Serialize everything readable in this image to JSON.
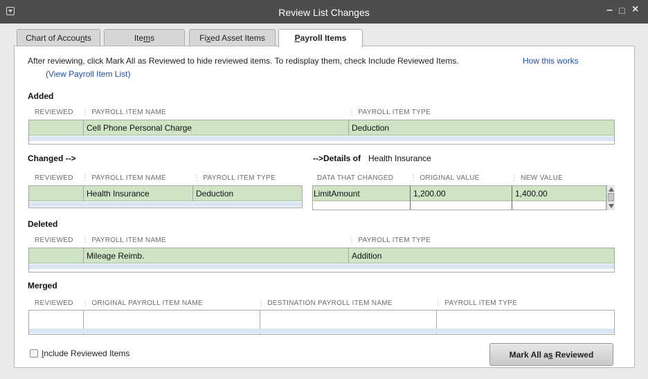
{
  "window": {
    "title": "Review List Changes",
    "controls": {
      "minimize": "–",
      "restore": "□",
      "close": "×"
    }
  },
  "tabs": [
    {
      "label_pre": "Chart of Accou",
      "label_u": "n",
      "label_post": "ts"
    },
    {
      "label_pre": "Ite",
      "label_u": "m",
      "label_post": "s"
    },
    {
      "label_pre": "Fi",
      "label_u": "x",
      "label_post": "ed Asset Items"
    },
    {
      "label_pre": "",
      "label_u": "P",
      "label_post": "ayroll Items"
    }
  ],
  "intro": {
    "text": "After reviewing, click Mark All as Reviewed to hide reviewed items. To redisplay them, check Include Reviewed Items.",
    "how_link": "How this works",
    "view_link": "(View Payroll Item List)"
  },
  "added": {
    "title": "Added",
    "headers": [
      "REVIEWED",
      "PAYROLL ITEM NAME",
      "PAYROLL ITEM TYPE"
    ],
    "rows": [
      {
        "name": "Cell Phone Personal Charge",
        "type": "Deduction"
      }
    ]
  },
  "changed": {
    "title": "Changed  -->",
    "headers": [
      "REVIEWED",
      "PAYROLL ITEM NAME",
      "PAYROLL ITEM TYPE"
    ],
    "rows": [
      {
        "name": "Health Insurance",
        "type": "Deduction"
      }
    ]
  },
  "details": {
    "title": "-->Details of",
    "item": "Health Insurance",
    "headers": [
      "DATA THAT CHANGED",
      "ORIGINAL VALUE",
      "NEW VALUE"
    ],
    "rows": [
      {
        "field": "LimitAmount",
        "original": "1,200.00",
        "new": "1,400.00"
      }
    ]
  },
  "deleted": {
    "title": "Deleted",
    "headers": [
      "REVIEWED",
      "PAYROLL ITEM NAME",
      "PAYROLL ITEM TYPE"
    ],
    "rows": [
      {
        "name": "Mileage Reimb.",
        "type": "Addition"
      }
    ]
  },
  "merged": {
    "title": "Merged",
    "headers": [
      "REVIEWED",
      "ORIGINAL PAYROLL ITEM NAME",
      "DESTINATION PAYROLL ITEM NAME",
      "PAYROLL ITEM TYPE"
    ]
  },
  "footer": {
    "include_pre": "",
    "include_u": "I",
    "include_post": "nclude Reviewed Items",
    "include_checked": false,
    "mark_pre": "Mark All a",
    "mark_u": "s",
    "mark_post": " Reviewed"
  }
}
